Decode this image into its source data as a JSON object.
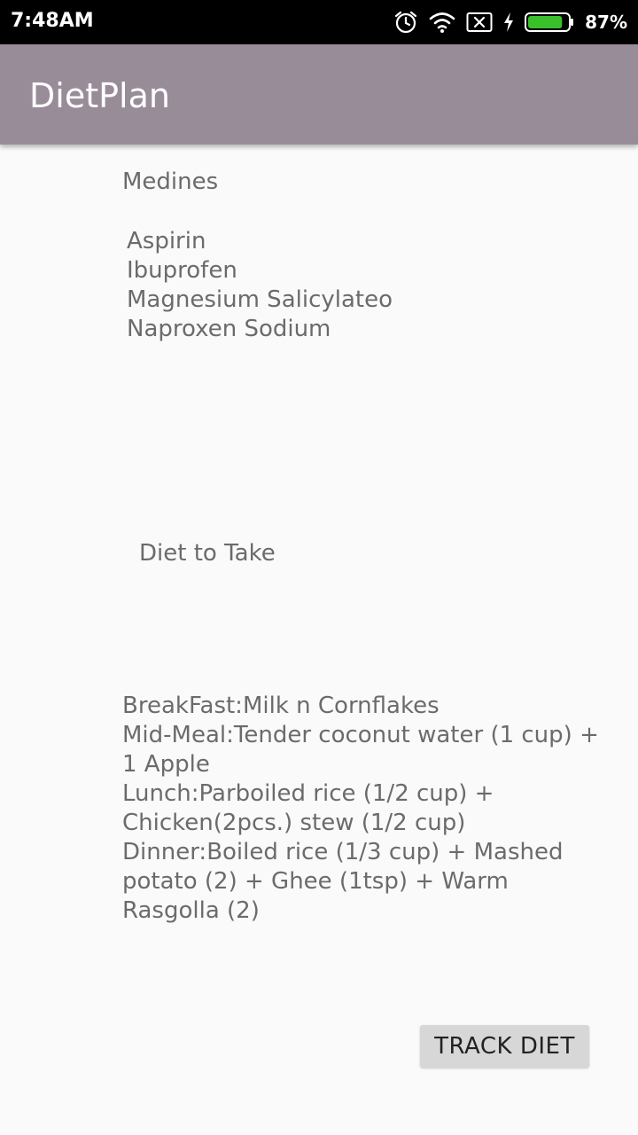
{
  "status_bar": {
    "time": "7:48AM",
    "battery_percent": "87%",
    "battery_level": 0.87,
    "icons": [
      "alarm-icon",
      "wifi-icon",
      "no-sim-icon",
      "charging-icon",
      "battery-icon"
    ]
  },
  "app_bar": {
    "title": "DietPlan",
    "color": "#998c99"
  },
  "medicines": {
    "heading": "Medines",
    "items": "Aspirin\nIbuprofen\nMagnesium Salicylateo\nNaproxen Sodium"
  },
  "diet": {
    "heading": "Diet to Take",
    "plan": "BreakFast:Milk n Cornflakes\nMid-Meal:Tender coconut water (1 cup) + 1 Apple\nLunch:Parboiled rice (1/2 cup) + Chicken(2pcs.) stew (1/2 cup)\nDinner:Boiled rice (1/3 cup) + Mashed potato (2) + Ghee (1tsp) + Warm Rasgolla (2)"
  },
  "actions": {
    "track_label": "TRACK DIET"
  }
}
